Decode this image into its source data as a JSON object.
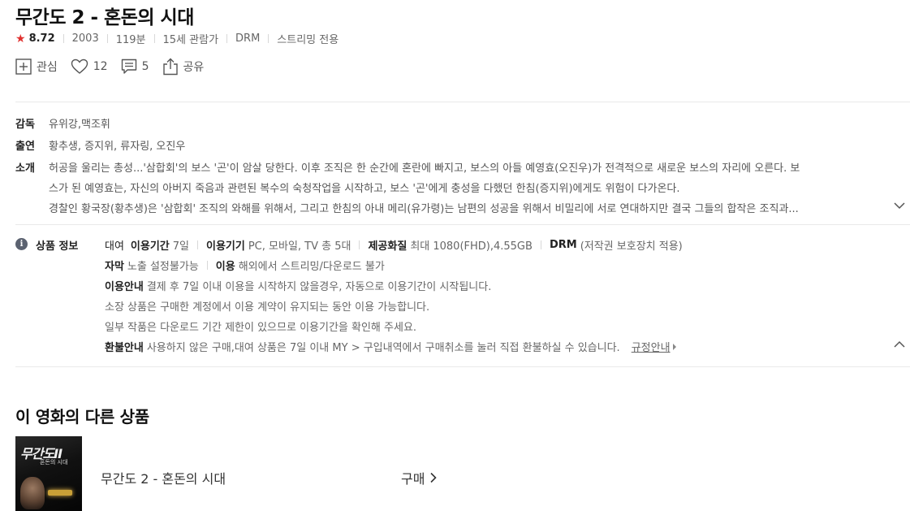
{
  "title": "무간도 2 - 혼돈의 시대",
  "meta": {
    "rating": "8.72",
    "year": "2003",
    "runtime": "119분",
    "age": "15세 관람가",
    "drm": "DRM",
    "streaming": "스트리밍 전용"
  },
  "actions": {
    "wish_label": "관심",
    "like_count": "12",
    "comment_count": "5",
    "share_label": "공유"
  },
  "credits": {
    "director_key": "감독",
    "director": "유위강,맥조휘",
    "cast_key": "출연",
    "cast": "황추생, 증지위, 류자링, 오진우",
    "synopsis_key": "소개",
    "synopsis_lines": [
      "허공을 울리는 총성...'삼합회'의 보스 '곤'이 암살 당한다. 이후 조직은 한 순간에 혼란에 빠지고, 보스의 아들 예영효(오진우)가 전격적으로 새로운 보스의 자리에 오른다. 보",
      "스가 된 예영효는, 자신의 아버지 죽음과 관련된 복수의 숙청작업을 시작하고, 보스 '곤'에게 충성을 다했던 한침(증지위)에게도 위험이 다가온다.",
      "경찰인 황국장(황추생)은 '삼합회' 조직의 와해를 위해서, 그리고 한침의 아내 메리(유가령)는 남편의 성공을 위해서 비밀리에 서로 연대하지만 결국 그들의 합작은 조직과..."
    ]
  },
  "product_info": {
    "heading": "상품 정보",
    "rent_label": "대여",
    "period_key": "이용기간",
    "period": "7일",
    "device_key": "이용기기",
    "device": "PC, 모바일, TV 총 5대",
    "quality_key": "제공화질",
    "quality": "최대 1080(FHD),4.55GB",
    "drm_key": "DRM",
    "drm": "(저작권 보호장치 적용)",
    "subtitle_key": "자막",
    "subtitle": "노출 설정불가능",
    "usage_key": "이용",
    "usage": "해외에서 스트리밍/다운로드 불가",
    "guide_key": "이용안내",
    "guide_1": "결제 후 7일 이내 이용을 시작하지 않을경우, 자동으로 이용기간이 시작됩니다.",
    "guide_2": "소장 상품은 구매한 계정에서 이용 계약이 유지되는 동안 이용 가능합니다.",
    "guide_3": "일부 작품은 다운로드 기간 제한이 있으므로 이용기간을 확인해 주세요.",
    "refund_key": "환불안내",
    "refund": "사용하지 않은 구매,대여 상품은 7일 이내 MY > 구입내역에서 구매취소를 눌러 직접 환불하실 수 있습니다.",
    "refund_link": "규정안내"
  },
  "other_products": {
    "heading": "이 영화의 다른 상품",
    "items": [
      {
        "poster_text": "무간도II",
        "poster_sub": "혼돈의 시대",
        "title": "무간도 2 - 혼돈의 시대",
        "action": "구매"
      }
    ]
  },
  "colors": {
    "star": "#e0312f",
    "text": "#222222",
    "muted": "#666666",
    "divider": "#e9e9e9"
  }
}
